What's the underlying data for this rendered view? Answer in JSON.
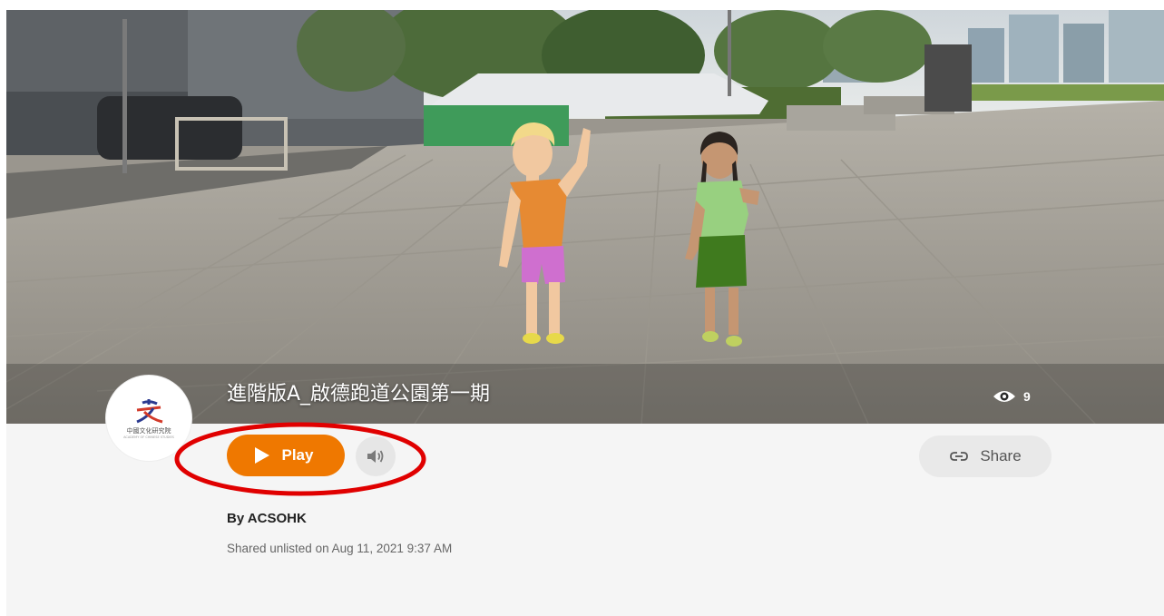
{
  "experience": {
    "title": "進階版A_啟德跑道公園第一期",
    "views": "9"
  },
  "publisher": {
    "logo_text": "中國文化研究院",
    "logo_subtext": "ACADEMY OF CHINESE STUDIES",
    "author": "By ACSOHK",
    "shared_info": "Shared unlisted on Aug 11, 2021 9:37 AM"
  },
  "controls": {
    "play_label": "Play",
    "share_label": "Share"
  },
  "icons": {
    "play": "play-icon",
    "sound": "speaker-icon",
    "share": "link-icon",
    "views": "eye-icon"
  },
  "colors": {
    "play_button": "#ef7800",
    "annotation": "#e00000",
    "panel_background": "#f5f5f5"
  }
}
